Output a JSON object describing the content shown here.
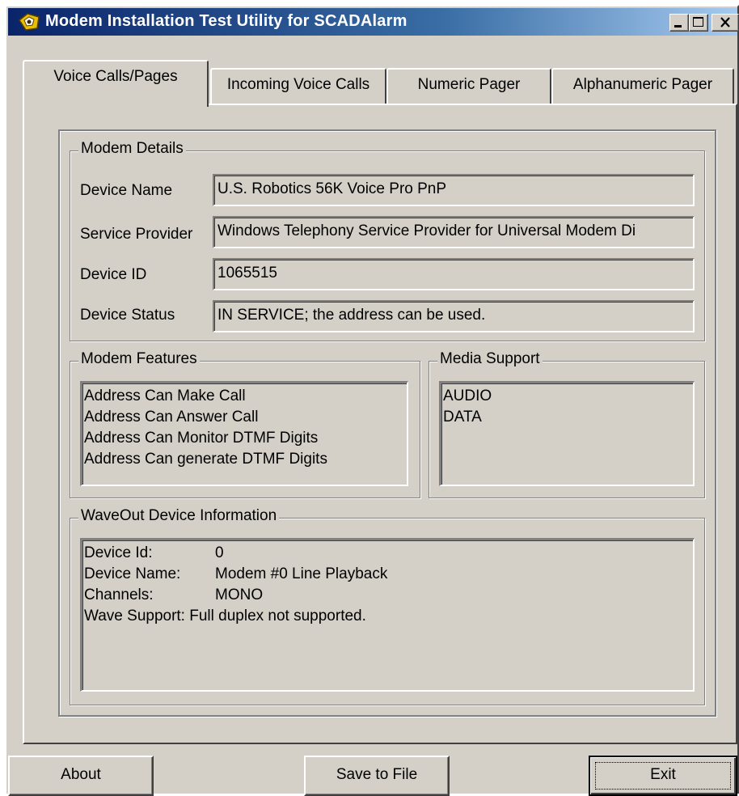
{
  "window": {
    "title": "Modem Installation Test Utility for SCADAlarm"
  },
  "tabs": [
    {
      "label": "Voice Calls/Pages",
      "active": true
    },
    {
      "label": "Incoming Voice Calls",
      "active": false
    },
    {
      "label": "Numeric Pager",
      "active": false
    },
    {
      "label": "Alphanumeric Pager",
      "active": false
    }
  ],
  "modem_details": {
    "legend": "Modem Details",
    "device_name_label": "Device Name",
    "device_name_value": "U.S. Robotics 56K Voice Pro PnP",
    "service_provider_label": "Service Provider",
    "service_provider_value": "Windows Telephony Service Provider for Universal Modem Di",
    "device_id_label": "Device ID",
    "device_id_value": "1065515",
    "device_status_label": "Device Status",
    "device_status_value": "IN SERVICE; the address can be used."
  },
  "modem_features": {
    "legend": "Modem Features",
    "items": [
      "Address Can Make Call",
      "Address Can Answer Call",
      "Address Can Monitor DTMF Digits",
      "Address Can generate DTMF Digits"
    ]
  },
  "media_support": {
    "legend": "Media Support",
    "items": [
      "AUDIO",
      "DATA"
    ]
  },
  "waveout": {
    "legend": "WaveOut Device Information",
    "rows": [
      {
        "key": "Device Id:",
        "value": "0"
      },
      {
        "key": "Device Name:",
        "value": "Modem #0 Line Playback"
      },
      {
        "key": "Channels:",
        "value": "MONO"
      },
      {
        "key": "Wave Support:",
        "value": "Full duplex not supported."
      }
    ]
  },
  "buttons": {
    "about": "About",
    "save": "Save to File",
    "exit": "Exit"
  },
  "colors": {
    "face": "#d4d0c8",
    "title_start": "#0a246a",
    "title_end": "#a6caf0"
  },
  "icons": [
    "app-icon",
    "minimize-icon",
    "maximize-icon",
    "close-icon"
  ]
}
